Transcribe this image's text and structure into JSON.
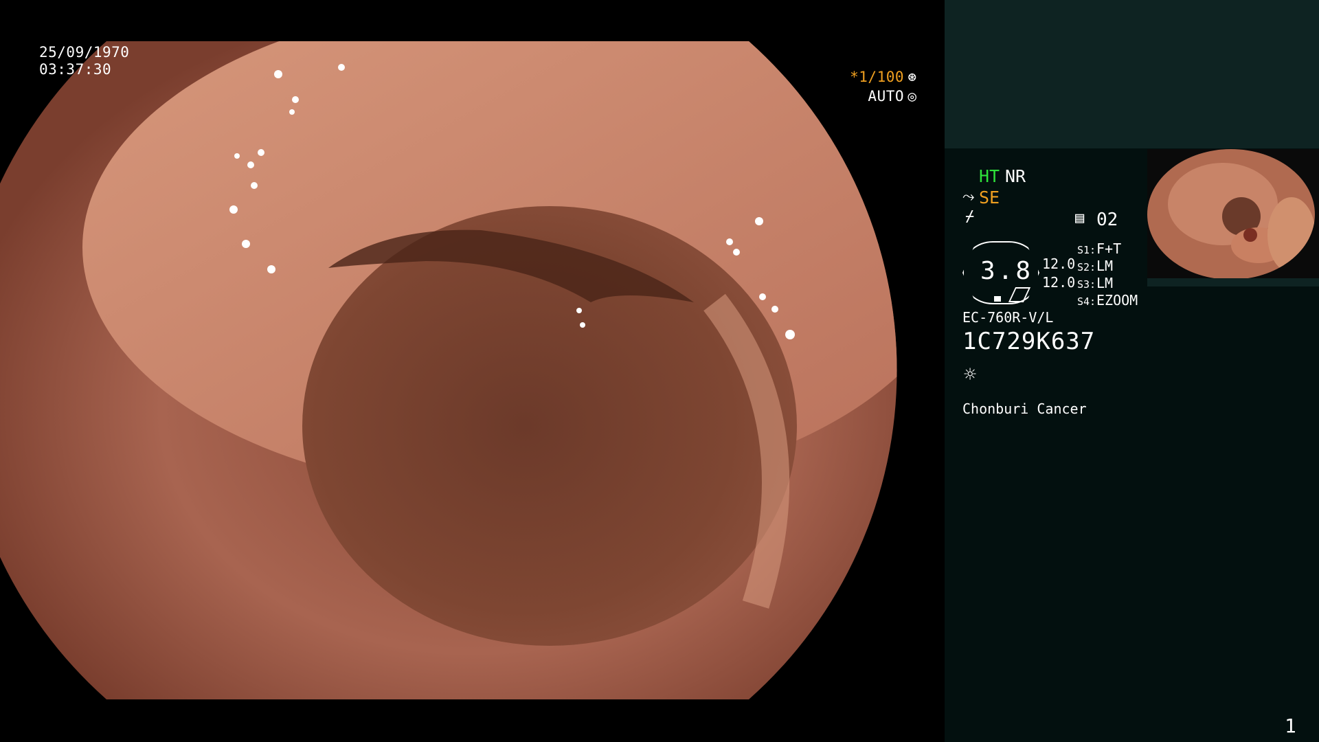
{
  "overlay": {
    "date": "25/09/1970",
    "time": "03:37:30",
    "shutter_speed": "*1/100",
    "iris_mode": "AUTO",
    "shutter_icon": "aperture-icon",
    "iris_icon": "iris-icon"
  },
  "panel": {
    "ht": "HT",
    "nr": "NR",
    "se_icon": "structure-enhance-icon",
    "se": "SE",
    "freeze_icon": "freeze-icon",
    "memory_icon": "memory-icon",
    "memory_slot": "02",
    "zoom_value": "3.8",
    "values": [
      "12.0",
      "12.0"
    ],
    "switches": [
      {
        "key": "S1:",
        "value": "F+T"
      },
      {
        "key": "S2:",
        "value": "LM"
      },
      {
        "key": "S3:",
        "value": "LM"
      },
      {
        "key": "S4:",
        "value": "EZOOM"
      }
    ],
    "scope_model": "EC-760R-V/L",
    "serial": "1C729K637",
    "light_icon": "light-source-icon",
    "hospital": "Chonburi Cancer",
    "page_number": "1"
  },
  "colors": {
    "ht": "#2ee23a",
    "se": "#f0a020",
    "shutter": "#f0a020",
    "panel_bg": "#03100f",
    "panel_header": "#0e2322",
    "tissue": "#b8705a",
    "lumen": "#6a3a2c"
  }
}
